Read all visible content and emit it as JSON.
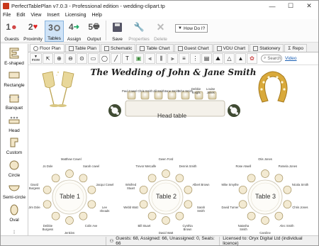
{
  "window": {
    "title": "PerfectTablePlan v7.0.3 - Professional edition - wedding-clipart.tp",
    "controls": [
      "—",
      "☐",
      "✕"
    ]
  },
  "menu": [
    "File",
    "Edit",
    "View",
    "Insert",
    "Licensing",
    "Help"
  ],
  "toolbar": {
    "guests": "Guests",
    "proximity": "Proximity",
    "tables": "Tables",
    "assign": "Assign",
    "output": "Output",
    "save": "Save",
    "properties": "Properties",
    "delete": "Delete",
    "howdo": "How Do I?"
  },
  "palette": [
    "E-shaped",
    "Rectangle",
    "Banquet",
    "Head",
    "Custom",
    "Circle",
    "Semi-circle",
    "Oval"
  ],
  "tabs": [
    "Floor Plan",
    "Table Plan",
    "Schematic",
    "Table Chart",
    "Guest Chart",
    "VDU Chart",
    "Stationery",
    "Repo"
  ],
  "subtoolbar": {
    "more": "more",
    "search_placeholder": "Search",
    "video": "Video"
  },
  "plan": {
    "title": "The Wedding of John & Jane Smith",
    "head_table_label": "Head table",
    "head_names": [
      {
        "n": "Paul Cowel"
      },
      {
        "n": "Chris Smith"
      },
      {
        "n": "Jill Smith"
      },
      {
        "n": "Jane Smith"
      },
      {
        "n": "John Smith"
      },
      {
        "n": "Debbie\nKnight"
      },
      {
        "n": "Louise\nJones"
      }
    ],
    "tables": [
      {
        "label": "Table 1",
        "names": [
          "Matthew Cowel",
          "Sarah cowel",
          "Jacqui Cowel",
          "Lee\nnheads",
          "Colin Ave",
          "Jenkins",
          "Debbie\nBurgess",
          "Jim Dole",
          "David\nBurgess",
          "Jo Dole"
        ]
      },
      {
        "label": "Table 2",
        "names": [
          "Gwen Ford",
          "Dennis Smith",
          "Albert Brown",
          "Sarah\nSmith",
          "Cynthia\nBrown",
          "David Watt",
          "Bill Stuart",
          "Webb Watt",
          "Winifred\nStuart",
          "Trevor Metcalfe"
        ]
      },
      {
        "label": "Table 3",
        "names": [
          "Otis Jones",
          "Pamela Jones",
          "Nicola Smith",
          "Chris Jones",
          "Alec Smith",
          "Caroline\nMcGregor",
          "Natasha\nSmith",
          "David Turner",
          "Mike Smythe",
          "Rose Atwell"
        ]
      }
    ]
  },
  "status": {
    "counts": "Guests: 68, Assigned: 66, Unassigned: 0, Seats: 66",
    "license": "Licensed to: Oryx Digital Ltd (individual licence)"
  }
}
